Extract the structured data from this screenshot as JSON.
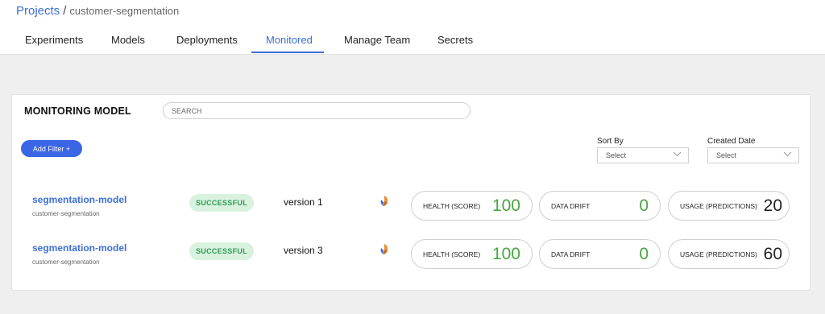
{
  "breadcrumb": {
    "projects": "Projects",
    "separator": "/",
    "current": "customer-segmentation"
  },
  "tabs": [
    {
      "label": "Experiments"
    },
    {
      "label": "Models"
    },
    {
      "label": "Deployments"
    },
    {
      "label": "Monitored",
      "active": true
    },
    {
      "label": "Manage Team"
    },
    {
      "label": "Secrets"
    }
  ],
  "panel": {
    "title": "MONITORING MODEL",
    "search_placeholder": "SEARCH",
    "add_filter": "Add Filter +",
    "sort_by": {
      "label": "Sort By",
      "value": "Select"
    },
    "created_date": {
      "label": "Created Date",
      "value": "Select"
    }
  },
  "rows": [
    {
      "name": "segmentation-model",
      "project": "customer-segmentation",
      "status": "SUCCESSFUL",
      "version": "version 1",
      "health_label": "HEALTH (SCORE)",
      "health_value": "100",
      "drift_label": "DATA DRIFT",
      "drift_value": "0",
      "usage_label": "USAGE (PREDICTIONS)",
      "usage_value": "20"
    },
    {
      "name": "segmentation-model",
      "project": "customer-segmentation",
      "status": "SUCCESSFUL",
      "version": "version 3",
      "health_label": "HEALTH (SCORE)",
      "health_value": "100",
      "drift_label": "DATA DRIFT",
      "drift_value": "0",
      "usage_label": "USAGE (PREDICTIONS)",
      "usage_value": "60"
    }
  ],
  "colors": {
    "accent": "#3b6fd6",
    "button": "#3a66e6",
    "success_bg": "#d9f2df",
    "success_text": "#2f9a55",
    "metric_green": "#46a642"
  },
  "icons": {
    "chevron": "chevron-down-icon",
    "framework": "framework-logo-icon"
  }
}
